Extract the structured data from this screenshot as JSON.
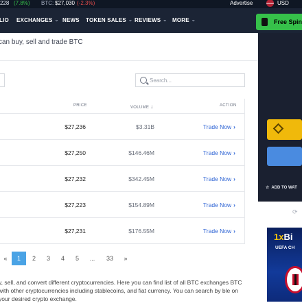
{
  "ticker": {
    "left_value": "228",
    "left_change": "(7.8%)",
    "btc_label": "BTC:",
    "btc_price": "$27,030",
    "btc_change": "(-2.3%)",
    "advertise": "Advertise",
    "currency": "USD"
  },
  "nav": {
    "items": [
      {
        "label": "LIO"
      },
      {
        "label": "EXCHANGES"
      },
      {
        "label": "NEWS"
      },
      {
        "label": "TOKEN SALES"
      },
      {
        "label": "REVIEWS"
      },
      {
        "label": "MORE"
      }
    ],
    "free_spins": "Free Spins"
  },
  "page": {
    "subtitle": "can buy, sell and trade BTC"
  },
  "search": {
    "placeholder": "Search..."
  },
  "table": {
    "headers": {
      "price": "PRICE",
      "volume": "VOLUME",
      "volume_sort": "↓",
      "action": "ACTION"
    },
    "rows": [
      {
        "price": "$27,236",
        "volume": "$3.31B",
        "action": "Trade Now"
      },
      {
        "price": "$27,250",
        "volume": "$146.46M",
        "action": "Trade Now"
      },
      {
        "price": "$27,232",
        "volume": "$342.45M",
        "action": "Trade Now"
      },
      {
        "price": "$27,223",
        "volume": "$154.89M",
        "action": "Trade Now"
      },
      {
        "price": "$27,231",
        "volume": "$176.55M",
        "action": "Trade Now"
      }
    ]
  },
  "pagination": {
    "prev": "«",
    "pages": [
      "1",
      "2",
      "3",
      "4",
      "5",
      "...",
      "33"
    ],
    "next": "»",
    "current": "1"
  },
  "description": "y, sell, and convert different cryptocurrencies. Here you can find list of all BTC exchanges BTC with other cryptocurrencies including stablecoins, and fiat currency. You can search by ble on your desired crypto exchange.",
  "sidebar": {
    "add_to_watchlist": "ADD TO WAT",
    "ad_brand_prefix": "1x",
    "ad_brand_suffix": "Bi",
    "ad_sub": "UEFA CH"
  },
  "colors": {
    "accent_blue": "#2d63d4",
    "positive": "#36c14a",
    "negative": "#e24b4b",
    "page_active": "#4aa3e5"
  }
}
